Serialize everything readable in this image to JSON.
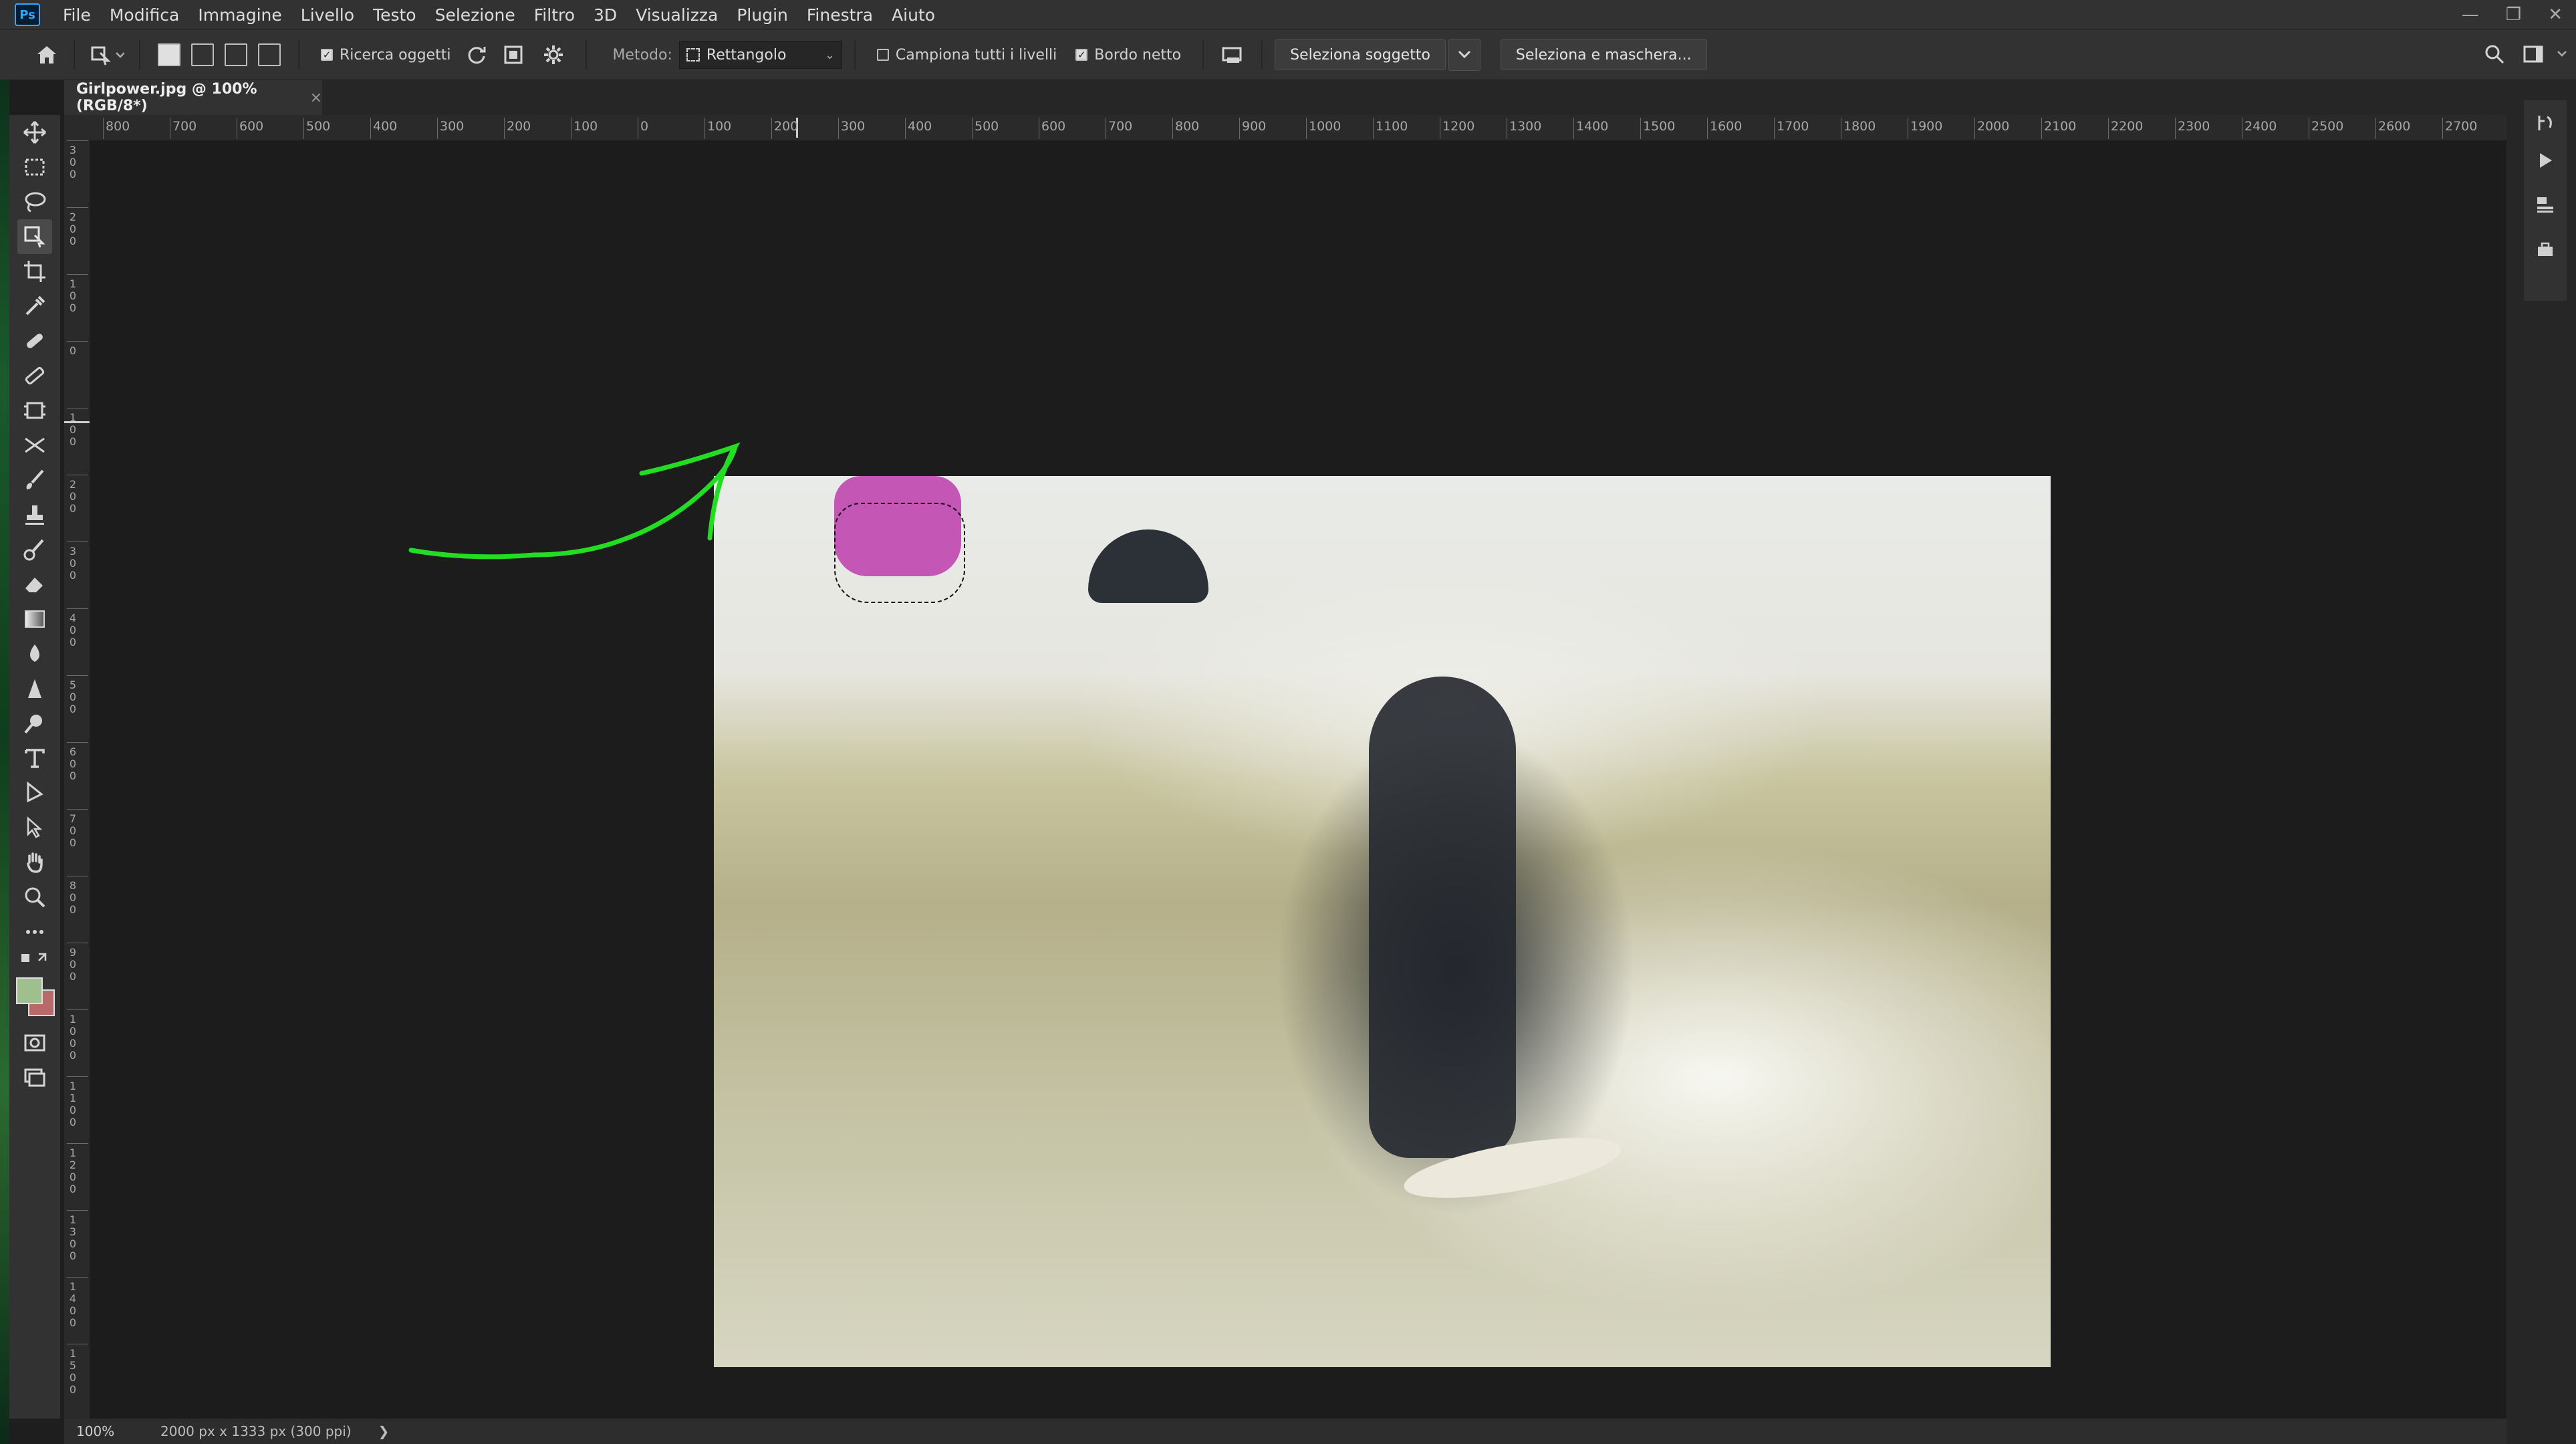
{
  "app": {
    "logo": "Ps"
  },
  "menu": [
    "File",
    "Modifica",
    "Immagine",
    "Livello",
    "Testo",
    "Selezione",
    "Filtro",
    "3D",
    "Visualizza",
    "Plugin",
    "Finestra",
    "Aiuto"
  ],
  "window_controls": {
    "minimize": "—",
    "restore": "❐",
    "close": "✕"
  },
  "options": {
    "ricerca_oggetti": {
      "label": "Ricerca oggetti",
      "checked": true
    },
    "metodo_label": "Metodo:",
    "metodo_value": "Rettangolo",
    "campiona": {
      "label": "Campiona tutti i livelli",
      "checked": false
    },
    "bordo_netto": {
      "label": "Bordo netto",
      "checked": true
    },
    "seleziona_soggetto": "Seleziona soggetto",
    "seleziona_maschera": "Seleziona e maschera..."
  },
  "document": {
    "tab_title": "Girlpower.jpg @ 100% (RGB/8*)",
    "close": "×"
  },
  "ruler": {
    "h_labels": [
      "800",
      "700",
      "600",
      "500",
      "400",
      "300",
      "200",
      "100",
      "0",
      "100",
      "200",
      "300",
      "400",
      "500",
      "600",
      "700",
      "800",
      "900",
      "1000",
      "1100",
      "1200",
      "1300",
      "1400",
      "1500",
      "1600",
      "1700",
      "1800",
      "1900",
      "2000",
      "2100",
      "2200",
      "2300",
      "2400",
      "2500",
      "2600",
      "2700"
    ],
    "v_labels": [
      "300",
      "200",
      "100",
      "0",
      "100",
      "200",
      "300",
      "400",
      "500",
      "600",
      "700",
      "800",
      "900",
      "1000",
      "1100",
      "1200",
      "1300",
      "1400",
      "1500"
    ]
  },
  "status": {
    "zoom": "100%",
    "doc_info": "2000 px x 1333 px (300 ppi)",
    "arrow": "❯"
  },
  "colors": {
    "foreground": "#9fbf8f",
    "background": "#b86a6a",
    "annotation": "#22dd22",
    "selection_overlay": "#c456b5"
  },
  "icons": [
    "move-icon",
    "marquee-icon",
    "lasso-icon",
    "object-selection-icon",
    "crop-icon",
    "eyedropper-icon",
    "healing-icon",
    "patch-icon",
    "frame-icon",
    "content-aware-move-icon",
    "brush-icon",
    "stamp-icon",
    "history-brush-icon",
    "eraser-icon",
    "gradient-icon",
    "blur-icon",
    "sharpen-icon",
    "dodge-icon",
    "type-icon",
    "path-selection-icon",
    "direct-selection-icon",
    "hand-icon",
    "zoom-icon",
    "more-icon"
  ]
}
